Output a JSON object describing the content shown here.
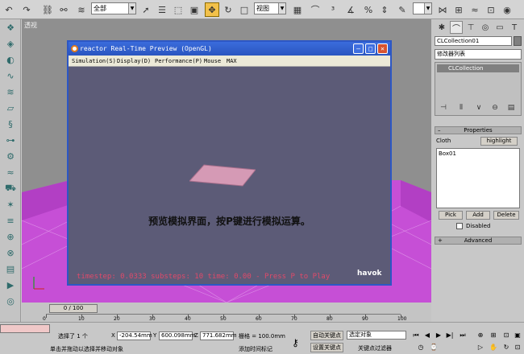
{
  "toolbar": {
    "selection_filter": "全部",
    "ref_coord": "视图",
    "icons": [
      "undo-icon",
      "redo-icon",
      "link-icon",
      "unlink-icon",
      "bind-spacewarp-icon",
      "select-icon",
      "select-by-name-icon",
      "region-select-icon",
      "window-crossing-icon",
      "move-icon",
      "rotate-icon",
      "scale-icon",
      "pivot-icon",
      "mirror-icon",
      "align-icon",
      "snap-icon",
      "angle-snap-icon",
      "percent-snap-icon",
      "spinner-snap-icon",
      "named-selection-icon",
      "curve-editor-icon",
      "schematic-icon",
      "material-editor-icon",
      "render-setup-icon",
      "quick-render-icon"
    ]
  },
  "viewport": {
    "label": "透视"
  },
  "reactor_window": {
    "title": "reactor Real-Time Preview (OpenGL)",
    "menu": [
      "Simulation(S)",
      "Display(D)",
      "Performance(P)",
      "Mouse",
      "MAX"
    ],
    "caption": "预览模拟界面，按P键进行模拟运算。",
    "timestep": "timestep: 0.0333 substeps: 10 time: 0.00 - Press P to Play",
    "logo": "havok"
  },
  "command_panel": {
    "object_name": "CLCollection01",
    "modifier_list": "修改器列表",
    "stack_item": "CLCollection",
    "properties_title": "Properties",
    "cloth_label": "Cloth",
    "highlight_label": "highlight",
    "list_items": [
      "Box01"
    ],
    "pick_label": "Pick",
    "add_label": "Add",
    "delete_label": "Delete",
    "disabled_label": "Disabled",
    "advanced_title": "Advanced"
  },
  "timeline": {
    "slider": "0 / 100",
    "ticks": [
      "0",
      "10",
      "20",
      "30",
      "40",
      "50",
      "60",
      "70",
      "80",
      "90",
      "100"
    ]
  },
  "status": {
    "selection": "选择了 1 个",
    "x_label": "X",
    "x_value": "-204.54mm",
    "y_label": "Y",
    "y_value": "600.098mm",
    "z_label": "Z",
    "z_value": "771.682mm",
    "grid": "栅格 = 100.0mm",
    "prompt": "单击并拖动以选择并移动对象",
    "add_time_tag": "添加时间标记",
    "auto_key": "自动关键点",
    "set_key": "设置关键点",
    "selected_set": "选定对象",
    "key_filters": "关键点过滤器"
  },
  "colors": {
    "floor": "#c64fd6",
    "reactor_bg": "#5c5b77",
    "timestep": "#e04a6a",
    "title_blue": "#2d57c4"
  }
}
